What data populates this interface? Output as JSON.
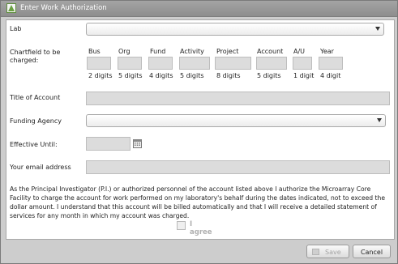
{
  "window": {
    "title": "Enter Work Authorization"
  },
  "form": {
    "lab_label": "Lab",
    "lab_value": "",
    "chartfield_label_line1": "Chartfield to be",
    "chartfield_label_line2": "charged:",
    "chartfield_columns": [
      {
        "name": "Bus",
        "hint": "2 digits",
        "value": ""
      },
      {
        "name": "Org",
        "hint": "5 digits",
        "value": ""
      },
      {
        "name": "Fund",
        "hint": "4 digits",
        "value": ""
      },
      {
        "name": "Activity",
        "hint": "5 digits",
        "value": ""
      },
      {
        "name": "Project",
        "hint": "8 digits",
        "value": ""
      },
      {
        "name": "Account",
        "hint": "5 digits",
        "value": ""
      },
      {
        "name": "A/U",
        "hint": "1 digit",
        "value": ""
      },
      {
        "name": "Year",
        "hint": "4 digit",
        "value": ""
      }
    ],
    "title_of_account_label": "Title of Account",
    "title_of_account_value": "",
    "funding_agency_label": "Funding Agency",
    "funding_agency_value": "",
    "effective_until_label": "Effective Until:",
    "effective_until_value": "",
    "email_label": "Your email address",
    "email_value": "",
    "authorization_text": "As the Principal Investigator (P.I.) or authorized personnel of the account listed above I authorize the Microarray Core Facility to charge the account for work performed on my laboratory's behalf during the dates indicated, not to exceed the dollar amount.  I understand that this account will be billed automatically and that I will receive a detailed statement of services for any month in which my account was charged.",
    "agree_label": "I agree",
    "agree_checked": false
  },
  "buttons": {
    "save": "Save",
    "cancel": "Cancel"
  },
  "icons": {
    "window": "app-icon",
    "calendar": "calendar-icon",
    "dropdown": "chevron-down-icon",
    "save": "save-icon"
  }
}
